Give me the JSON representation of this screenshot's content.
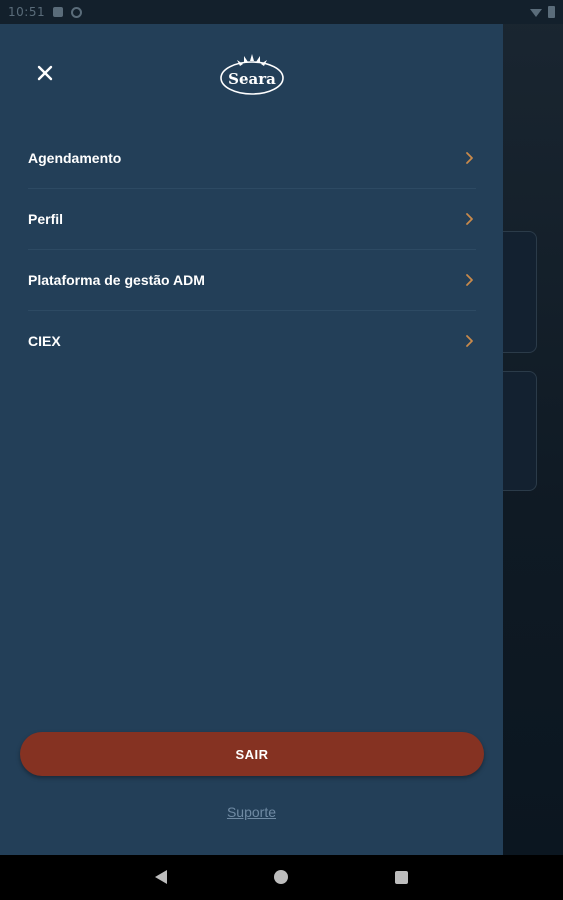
{
  "status_bar": {
    "time": "10:51"
  },
  "drawer": {
    "logo_text": "Seara",
    "menu_items": [
      {
        "label": "Agendamento"
      },
      {
        "label": "Perfil"
      },
      {
        "label": "Plataforma de gestão ADM"
      },
      {
        "label": "CIEX"
      }
    ],
    "logout_label": "SAIR",
    "support_label": "Suporte"
  },
  "colors": {
    "drawer_bg": "#233f58",
    "accent_chevron": "#c98a4b",
    "logout_button": "#853222",
    "support_link": "#6f8aa3"
  },
  "icons": {
    "close": "close-icon",
    "chevron": "chevron-right-icon",
    "nav_back": "back-icon",
    "nav_home": "home-icon",
    "nav_recent": "recent-apps-icon"
  }
}
